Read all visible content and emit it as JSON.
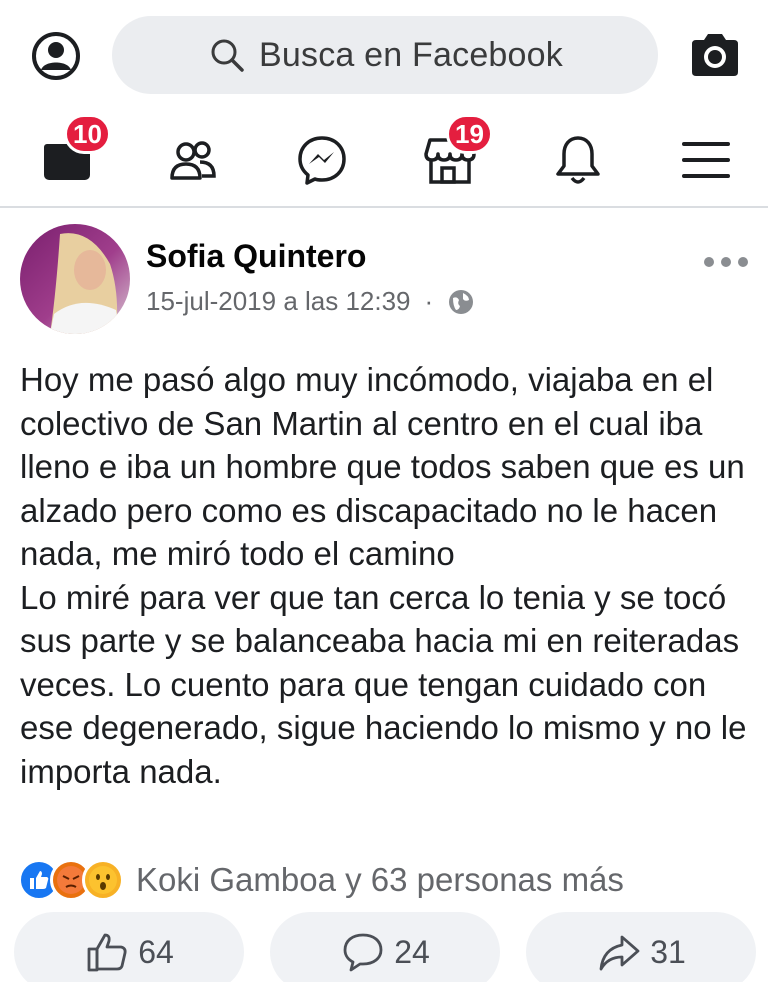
{
  "header": {
    "search_placeholder": "Busca en Facebook",
    "profile_icon": "user-circle-icon",
    "camera_icon": "camera-icon"
  },
  "nav": {
    "items": [
      {
        "name": "news-feed",
        "icon": "news-feed-icon",
        "badge": "10"
      },
      {
        "name": "friends",
        "icon": "friends-icon",
        "badge": ""
      },
      {
        "name": "messenger",
        "icon": "messenger-icon",
        "badge": ""
      },
      {
        "name": "marketplace",
        "icon": "marketplace-icon",
        "badge": "19"
      },
      {
        "name": "notifications",
        "icon": "bell-icon",
        "badge": ""
      },
      {
        "name": "menu",
        "icon": "hamburger-menu-icon",
        "badge": ""
      }
    ]
  },
  "post": {
    "author": "Sofia Quintero",
    "timestamp": "15-jul-2019 a las 12:39",
    "separator": "·",
    "privacy_icon": "globe-icon",
    "text": "Hoy me pasó algo muy incómodo, viajaba en el colectivo de San Martin al centro en el cual iba lleno e iba un hombre que todos saben que es un alzado pero como es discapacitado no le hacen nada, me miró todo el camino\nLo miré para ver que tan cerca lo tenia y se tocó sus parte y se balanceaba hacia mi en reiteradas veces. Lo cuento para que tengan cuidado con ese degenerado, sigue haciendo lo mismo y no le importa nada.",
    "reactions_summary": "Koki Gamboa y 63 personas más",
    "reaction_types": [
      "like",
      "angry",
      "wow"
    ]
  },
  "actions": {
    "like_count": "64",
    "comment_count": "24",
    "share_count": "31"
  },
  "colors": {
    "brand_blue": "#1877f2",
    "badge_red": "#e41e3f",
    "button_bg": "#f0f2f5",
    "search_bg": "#ebedf0"
  }
}
